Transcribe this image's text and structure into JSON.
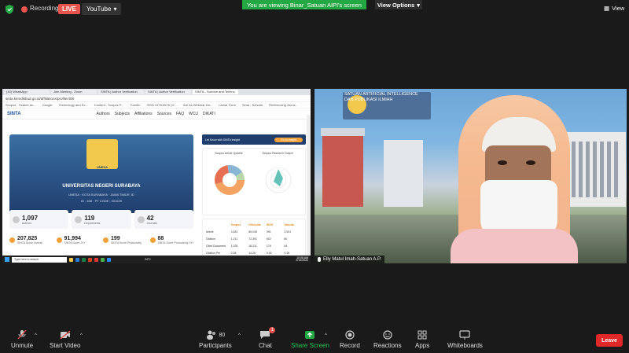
{
  "topbar": {
    "recording_label": "Recording",
    "live_label": "LIVE",
    "youtube_label": "YouTube",
    "viewing_banner": "You are viewing Binar_Satuan AIPI's screen",
    "view_options": "View Options",
    "view_label": "View"
  },
  "shared_screen": {
    "tabs": [
      "(43) WhatsApp",
      "Join Meeting - Zoom",
      "SINTA | Author Verification",
      "SINTA | Author Verification",
      "SINTA - Science and Techno"
    ],
    "address": "sinta.kemdikbud.go.id/affiliations/profile/408",
    "bookmarks": [
      "Scopus - Search Au...",
      "Google",
      "Technology and Ex...",
      "Content - Scopus P...",
      "Turnitin",
      "ISSN 1978-8576 (G...",
      "Are As Webinar Da...",
      "Lamar Form",
      "Sinta - Scholar",
      "Referencing Jouns..."
    ],
    "sinta_logo": "SINTA",
    "nav": [
      "Authors",
      "Subjects",
      "Affiliations",
      "Sources",
      "FAQ",
      "WCU",
      "DIKATI"
    ],
    "univ_logo_text": "UNESA",
    "univ_name": "UNIVERSITAS NEGERI SURABAYA",
    "univ_sub1": "UNESA · KOTA SURABAYA · JAWA TIMUR, ID",
    "univ_sub2": "ID : 408 · PT CODE : 001029",
    "stats": [
      {
        "num": "1,097",
        "label": "Authors"
      },
      {
        "num": "119",
        "label": "Departments"
      },
      {
        "num": "42",
        "label": "Journals"
      }
    ],
    "scores": [
      {
        "num": "207,825",
        "label": "SINTA Score Overall"
      },
      {
        "num": "91,994",
        "label": "SINTA Score 3Yr"
      },
      {
        "num": "199",
        "label": "SINTA Score Productivity"
      },
      {
        "num": "88",
        "label": "SINTA Score Productivity 3Yr"
      }
    ],
    "promo_text": "Let Know with SINTA Insight",
    "promo_button": "Go to Insight",
    "chart_labels": [
      "Scopus Article Quartile",
      "Scopus Research Output"
    ],
    "table_headers": [
      "",
      "Scopus",
      "GScholar",
      "WOS",
      "Garuda"
    ],
    "table_rows": [
      [
        "Article",
        "3,481",
        "66,045",
        "391",
        "3,931"
      ],
      [
        "Citation",
        "1,211",
        "72,391",
        "602",
        "80"
      ],
      [
        "Cited Document",
        "1,025",
        "18,211",
        "176",
        "64"
      ],
      [
        "Citation Per",
        "0.35",
        "14.26",
        "0.00",
        "0.26"
      ]
    ],
    "taskbar_search": "Type here to search",
    "taskbar_temp": "24°C",
    "taskbar_time": "10:08 AM",
    "taskbar_date": "2/14/2022"
  },
  "video": {
    "banner": "SATUAN ARTIFICIAL INTELLIGENCE DAN PUBLIKASI ILMIAH",
    "name_tag": "Elly Matul Imah-Satuan A.P."
  },
  "toolbar": {
    "unmute": "Unmute",
    "start_video": "Start Video",
    "participants": "Participants",
    "participants_count": "80",
    "chat": "Chat",
    "chat_badge": "1",
    "share_screen": "Share Screen",
    "record": "Record",
    "reactions": "Reactions",
    "apps": "Apps",
    "whiteboards": "Whiteboards",
    "leave": "Leave"
  },
  "colors": {
    "accent_green": "#23a843",
    "leave_red": "#e02828",
    "live_red": "#e8554e"
  }
}
